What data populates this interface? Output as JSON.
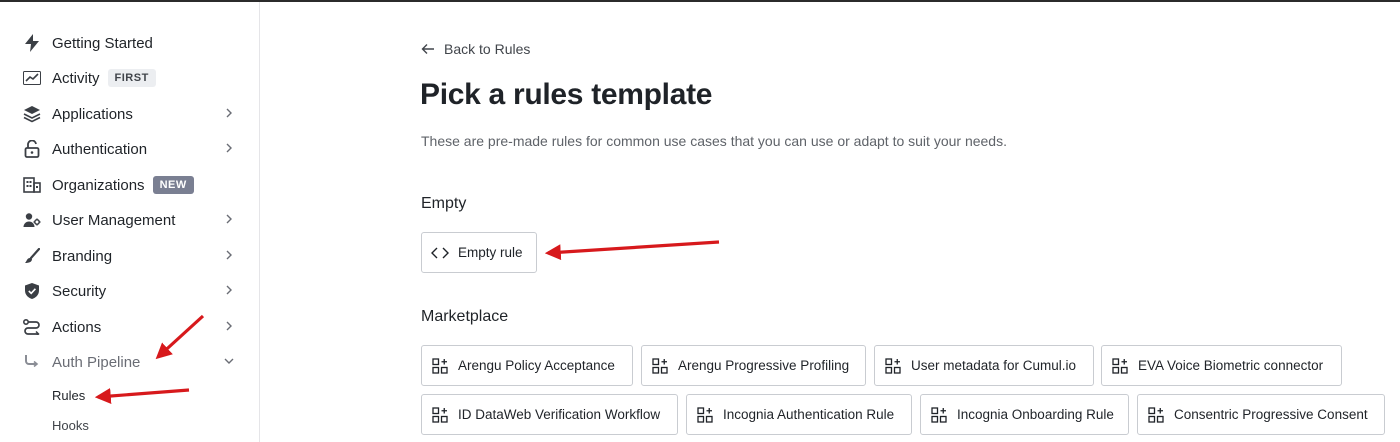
{
  "sidebar": {
    "items": [
      {
        "label": "Getting Started",
        "icon": "bolt-icon"
      },
      {
        "label": "Activity",
        "icon": "chart-icon",
        "badge": "FIRST"
      },
      {
        "label": "Applications",
        "icon": "layers-icon"
      },
      {
        "label": "Authentication",
        "icon": "lock-icon"
      },
      {
        "label": "Organizations",
        "icon": "building-icon",
        "badge": "NEW"
      },
      {
        "label": "User Management",
        "icon": "users-gear-icon"
      },
      {
        "label": "Branding",
        "icon": "brush-icon"
      },
      {
        "label": "Security",
        "icon": "shield-icon"
      },
      {
        "label": "Actions",
        "icon": "flow-icon"
      },
      {
        "label": "Auth Pipeline",
        "icon": "pipeline-icon"
      }
    ],
    "sub_items": [
      {
        "label": "Rules"
      },
      {
        "label": "Hooks"
      }
    ]
  },
  "main": {
    "back_label": "Back to Rules",
    "title": "Pick a rules template",
    "description": "These are pre-made rules for common use cases that you can use or adapt to suit your needs.",
    "sections": [
      {
        "title": "Empty",
        "templates": [
          {
            "label": "Empty rule",
            "icon": "code-icon"
          }
        ]
      },
      {
        "title": "Marketplace",
        "templates": [
          {
            "label": "Arengu Policy Acceptance",
            "icon": "grid-plus-icon"
          },
          {
            "label": "Arengu Progressive Profiling",
            "icon": "grid-plus-icon"
          },
          {
            "label": "User metadata for Cumul.io",
            "icon": "grid-plus-icon"
          },
          {
            "label": "EVA Voice Biometric connector",
            "icon": "grid-plus-icon"
          },
          {
            "label": "ID DataWeb Verification Workflow",
            "icon": "grid-plus-icon"
          },
          {
            "label": "Incognia Authentication Rule",
            "icon": "grid-plus-icon"
          },
          {
            "label": "Incognia Onboarding Rule",
            "icon": "grid-plus-icon"
          },
          {
            "label": "Consentric Progressive Consent",
            "icon": "grid-plus-icon"
          }
        ]
      }
    ]
  },
  "annotation_color": "#d7191c"
}
